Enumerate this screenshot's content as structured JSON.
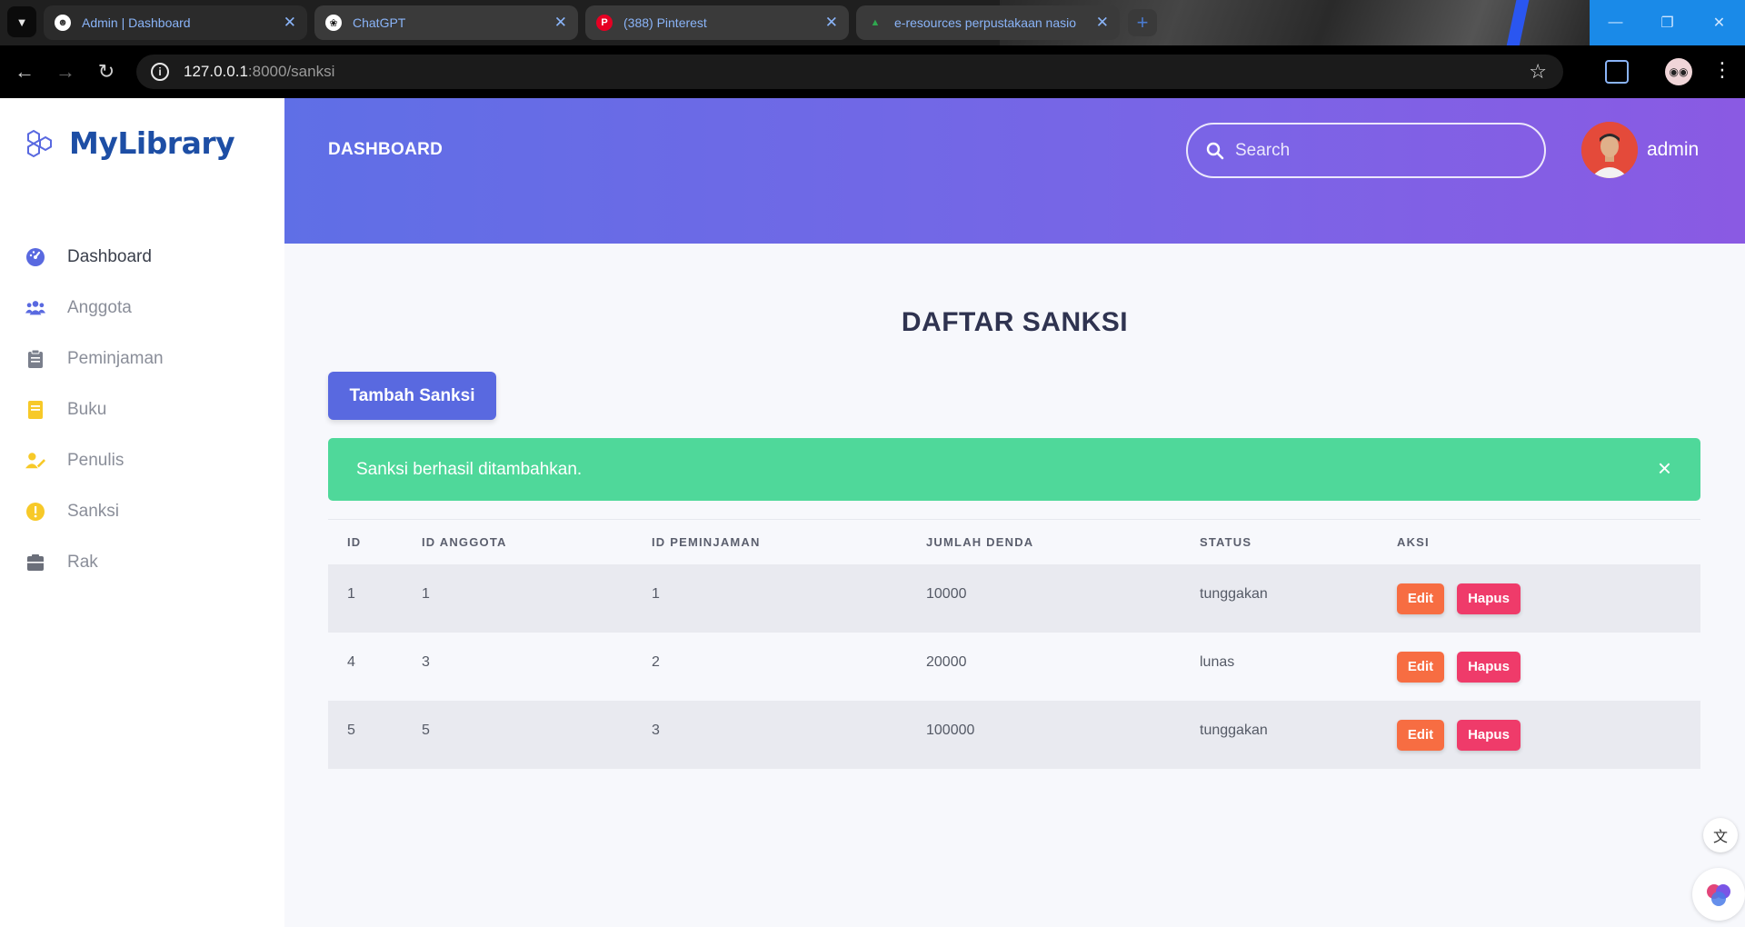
{
  "browser": {
    "tabs": [
      {
        "title": "Admin | Dashboard",
        "active": true
      },
      {
        "title": "ChatGPT",
        "active": false
      },
      {
        "title": "(388) Pinterest",
        "active": false
      },
      {
        "title": "e-resources perpustakaan nasio",
        "active": false
      }
    ],
    "url_host": "127.0.0.1",
    "url_path": ":8000/sanksi"
  },
  "sidebar": {
    "brand": "MyLibrary",
    "items": [
      {
        "label": "Dashboard",
        "icon": "dashboard-icon",
        "color": "#5969e0"
      },
      {
        "label": "Anggota",
        "icon": "users-icon",
        "color": "#5969e0"
      },
      {
        "label": "Peminjaman",
        "icon": "clipboard-icon",
        "color": "#7a7f8c"
      },
      {
        "label": "Buku",
        "icon": "book-icon",
        "color": "#f7c928"
      },
      {
        "label": "Penulis",
        "icon": "author-icon",
        "color": "#f7c928"
      },
      {
        "label": "Sanksi",
        "icon": "warning-icon",
        "color": "#f7c928"
      },
      {
        "label": "Rak",
        "icon": "shelf-icon",
        "color": "#6b6f7a"
      }
    ]
  },
  "header": {
    "title": "DASHBOARD",
    "search_placeholder": "Search",
    "username": "admin"
  },
  "main": {
    "title": "DAFTAR SANKSI",
    "add_button": "Tambah Sanksi",
    "alert": "Sanksi berhasil ditambahkan.",
    "alert_close": "×",
    "table": {
      "columns": [
        "ID",
        "ID ANGGOTA",
        "ID PEMINJAMAN",
        "JUMLAH DENDA",
        "STATUS",
        "AKSI"
      ],
      "rows": [
        {
          "id": "1",
          "id_anggota": "1",
          "id_peminjaman": "1",
          "jumlah_denda": "10000",
          "status": "tunggakan"
        },
        {
          "id": "4",
          "id_anggota": "3",
          "id_peminjaman": "2",
          "jumlah_denda": "20000",
          "status": "lunas"
        },
        {
          "id": "5",
          "id_anggota": "5",
          "id_peminjaman": "3",
          "jumlah_denda": "100000",
          "status": "tunggakan"
        }
      ],
      "edit_label": "Edit",
      "delete_label": "Hapus"
    }
  },
  "colors": {
    "accent": "#5969e0",
    "success": "#4fd89a",
    "edit": "#f76d42",
    "delete": "#ef3b6a"
  }
}
